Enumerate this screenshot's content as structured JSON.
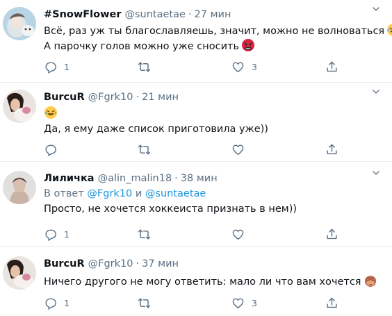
{
  "tweets": [
    {
      "name": "#SnowFlower",
      "handle": "@suntaetae",
      "time": "27 мин",
      "lines": [
        "Всё, раз уж ты благославляешь, значит, можно не волноваться",
        "А парочку голов можно уже сносить"
      ],
      "emojis": [
        "rolling-laugh-emoji",
        "angry-face-emoji"
      ],
      "reply_count": "1",
      "like_count": "3"
    },
    {
      "name": "BurcuR",
      "handle": "@Fgrk10",
      "time": "21 мин",
      "lines": [
        "",
        "Да, я ему даже список приготовила уже))"
      ],
      "emojis": [
        "rolling-laugh-emoji"
      ],
      "reply_count": "",
      "like_count": ""
    },
    {
      "name": "Лиличка",
      "handle": "@alin_malin18",
      "time": "38 мин",
      "reply_prefix": "В ответ",
      "reply_user1": "@Fgrk10",
      "reply_and": "и",
      "reply_user2": "@suntaetae",
      "lines": [
        "Просто, не хочется хоккеиста признать в нем))"
      ],
      "reply_count": "1",
      "like_count": ""
    },
    {
      "name": "BurcuR",
      "handle": "@Fgrk10",
      "time": "37 мин",
      "lines": [
        "Ничего другого не могу ответить: мало ли что вам хочется"
      ],
      "emojis": [
        "see-no-evil-monkey-emoji"
      ],
      "reply_count": "1",
      "like_count": "3"
    }
  ],
  "separator": "·",
  "icons": [
    "reply-icon",
    "retweet-icon",
    "like-icon",
    "share-icon",
    "more-caret-icon"
  ],
  "colors": {
    "text": "#0f1419",
    "muted": "#5b7083",
    "link": "#1b95e0",
    "border": "#e6ecf0"
  }
}
